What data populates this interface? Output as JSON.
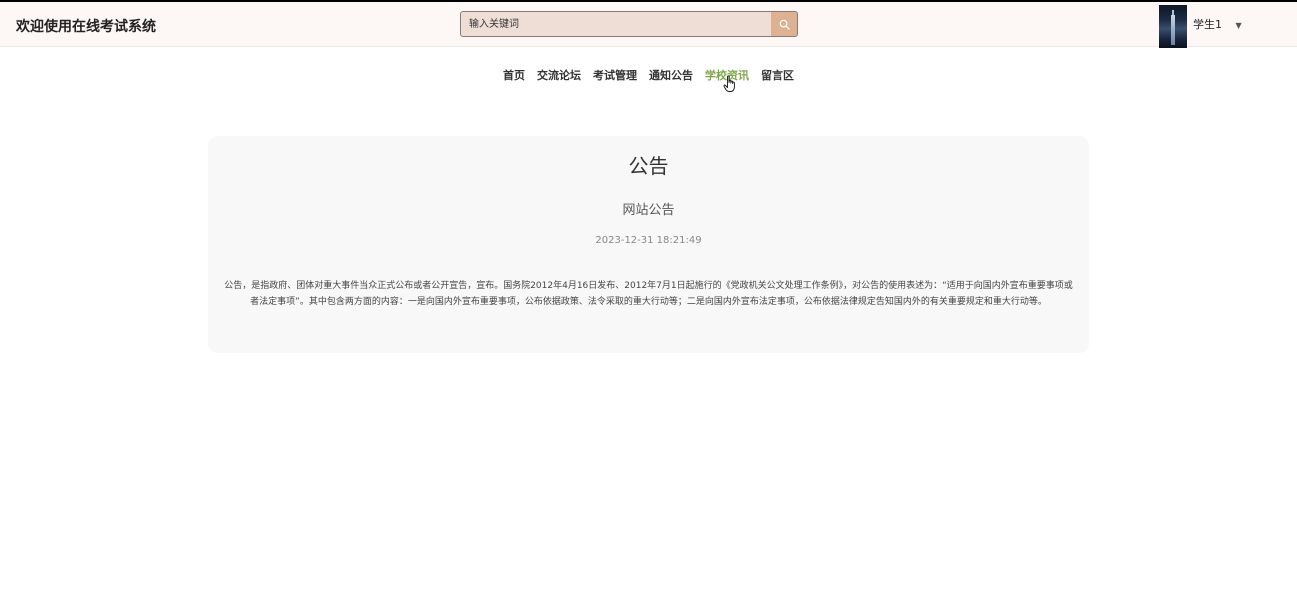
{
  "header": {
    "site_title": "欢迎使用在线考试系统",
    "search": {
      "placeholder": "输入关键词",
      "value": "",
      "button_icon": "search-icon"
    },
    "user": {
      "name": "学生1",
      "dropdown_icon": "caret-down-icon"
    }
  },
  "nav": {
    "items": [
      {
        "label": "首页"
      },
      {
        "label": "交流论坛"
      },
      {
        "label": "考试管理"
      },
      {
        "label": "通知公告"
      },
      {
        "label": "学校资讯",
        "active": true
      },
      {
        "label": "留言区"
      }
    ]
  },
  "notice": {
    "title": "公告",
    "subtitle": "网站公告",
    "date": "2023-12-31 18:21:49",
    "body": "公告，是指政府、团体对重大事件当众正式公布或者公开宣告，宣布。国务院2012年4月16日发布、2012年7月1日起施行的《党政机关公文处理工作条例》，对公告的使用表述为：“适用于向国内外宣布重要事项或者法定事项”。其中包含两方面的内容：一是向国内外宣布重要事项，公布依据政策、法令采取的重大行动等；二是向国内外宣布法定事项，公布依据法律规定告知国内外的有关重要规定和重大行动等。"
  },
  "colors": {
    "accent_nav_active": "#7fa64b",
    "header_bg": "#fdf7f6",
    "search_bg": "#eeded6",
    "search_button": "#ddb293",
    "card_bg": "#f8f8f8"
  }
}
